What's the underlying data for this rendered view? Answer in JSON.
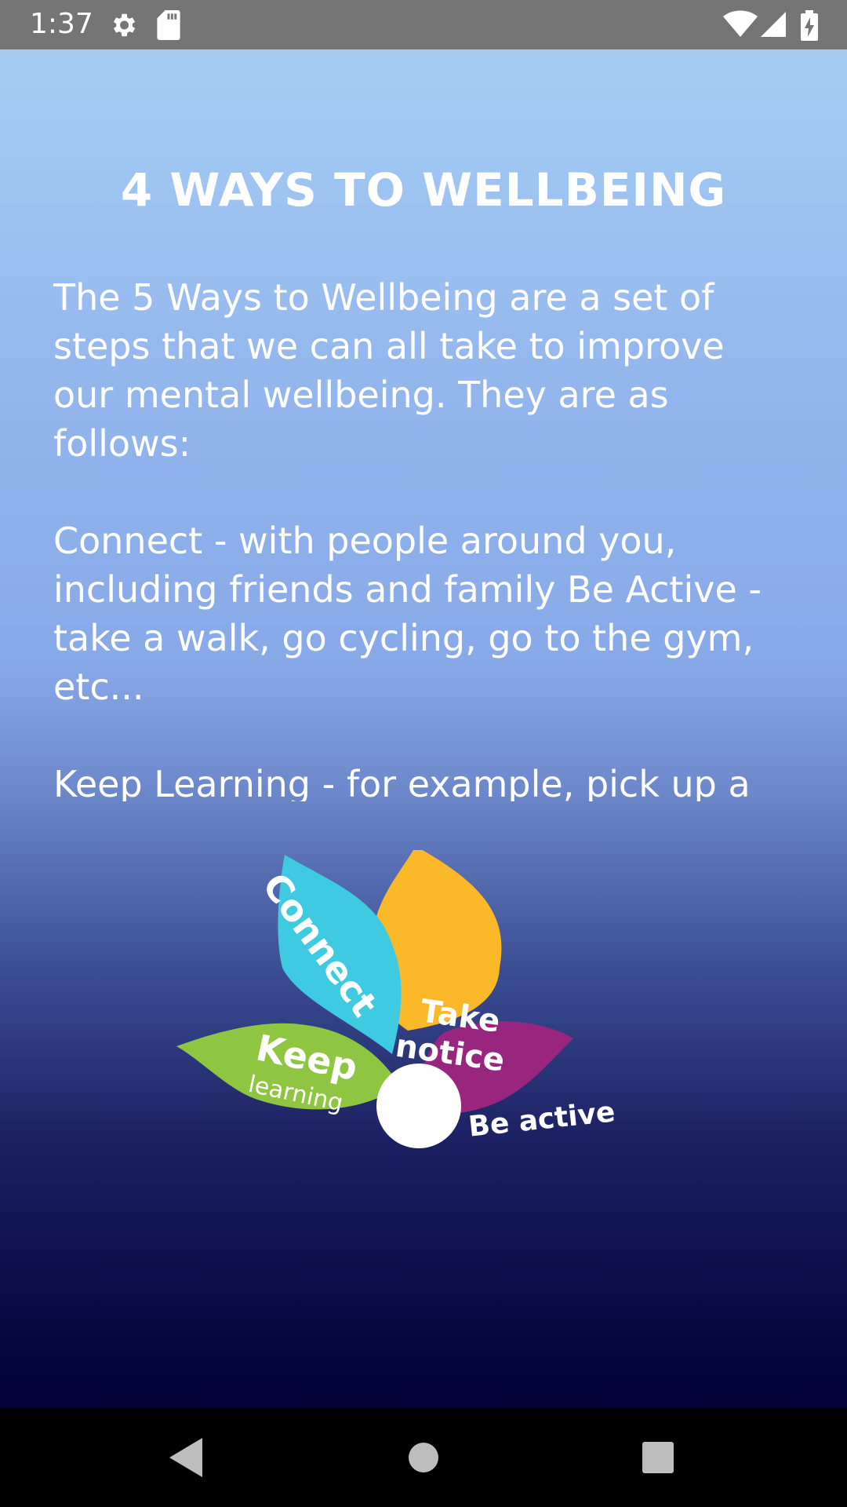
{
  "status_bar": {
    "time": "1:37",
    "icons": [
      "gear-icon",
      "sd-card-icon",
      "wifi-icon",
      "signal-icon",
      "battery-charging-icon"
    ]
  },
  "page": {
    "title": "4 WAYS TO WELLBEING",
    "paragraphs": [
      "The 5 Ways to Wellbeing are a set of steps that we can all take to improve our mental wellbeing. They are as follows:",
      "Connect - with people around you, including friends and family Be Active - take a walk, go cycling, go to the gym, etc...",
      "Keep Learning - for example, pick up a"
    ]
  },
  "flower": {
    "petals": [
      {
        "label": "Connect",
        "color": "#3ecbe2"
      },
      {
        "label_line1": "Take",
        "label_line2": "notice",
        "color": "#fbb829"
      },
      {
        "label_line1": "Keep",
        "label_line2": "learning",
        "color": "#8ec641"
      },
      {
        "label": "Be active",
        "color": "#98267f"
      }
    ],
    "center_color": "#ffffff"
  },
  "nav_bar": {
    "buttons": [
      "back-icon",
      "home-icon",
      "recents-icon"
    ]
  }
}
